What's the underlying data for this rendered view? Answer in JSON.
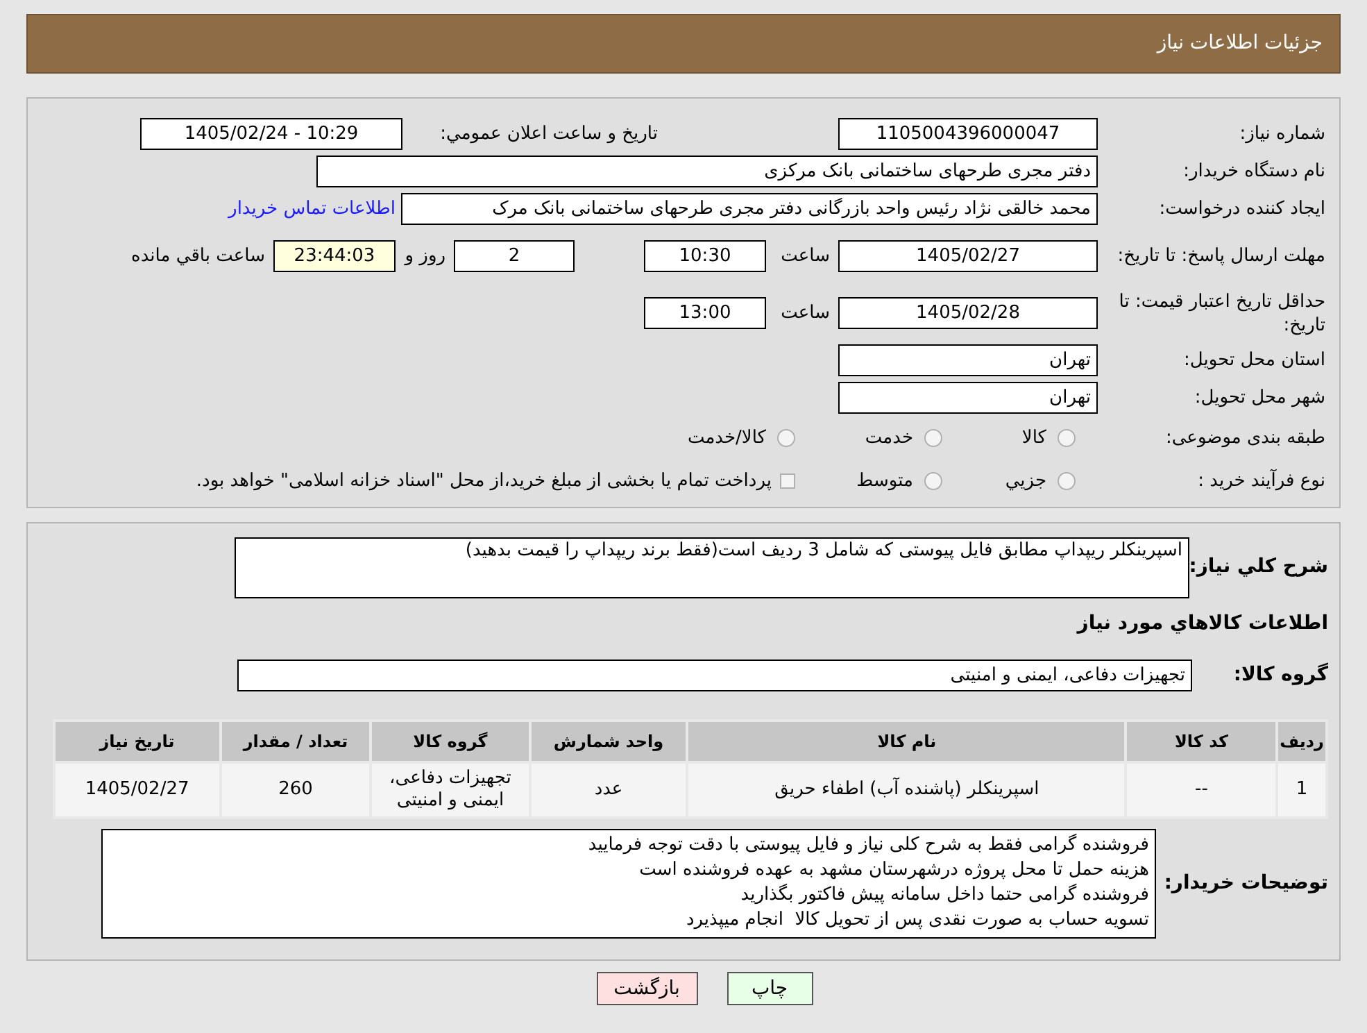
{
  "header": {
    "title": "جزئیات اطلاعات نیاز"
  },
  "details": {
    "need_number": {
      "label": "شماره نیاز:",
      "value": "1105004396000047"
    },
    "announce": {
      "label": "تاریخ و ساعت اعلان عمومي:",
      "value": "1405/02/24 - 10:29"
    },
    "buyer_org": {
      "label": "نام دستگاه خریدار:",
      "value": "دفتر مجری طرحهای ساختمانی بانک مرکزی"
    },
    "requester": {
      "label": "ایجاد کننده درخواست:",
      "value": "محمد خالقی نژاد رئیس واحد بازرگانی دفتر مجری طرحهای ساختمانی بانک مرک",
      "contact_link": "اطلاعات تماس خریدار"
    },
    "response_deadline": {
      "label": "مهلت ارسال پاسخ: تا تاریخ:",
      "date": "1405/02/27",
      "time_label": "ساعت",
      "time": "10:30",
      "days": "2",
      "days_label": "روز و",
      "remaining": "23:44:03",
      "remaining_label": "ساعت باقي مانده"
    },
    "price_validity": {
      "label": "حداقل تاریخ اعتبار قیمت: تا تاریخ:",
      "date": "1405/02/28",
      "time_label": "ساعت",
      "time": "13:00"
    },
    "province": {
      "label": "استان محل تحویل:",
      "value": "تهران"
    },
    "city": {
      "label": "شهر محل تحویل:",
      "value": "تهران"
    },
    "category": {
      "label": "طبقه بندی موضوعی:",
      "options": [
        {
          "label": "کالا",
          "selected": false
        },
        {
          "label": "خدمت",
          "selected": false
        },
        {
          "label": "کالا/خدمت",
          "selected": false
        }
      ]
    },
    "purchase_type": {
      "label": "نوع فرآیند خرید :",
      "options": [
        {
          "label": "جزيي",
          "selected": false
        },
        {
          "label": "متوسط",
          "selected": false
        }
      ],
      "treasury": {
        "label": "پرداخت تمام یا بخشی از مبلغ خرید،از محل \"اسناد خزانه اسلامی\" خواهد بود.",
        "checked": false
      }
    }
  },
  "summary": {
    "label": "شرح کلي نیاز:",
    "value": "اسپرینکلر ریپداپ مطابق فایل پیوستی که شامل 3 ردیف است(فقط برند ریپداپ را قیمت بدهید)"
  },
  "goods": {
    "title": "اطلاعات کالاهاي مورد نیاز",
    "group": {
      "label": "گروه کالا:",
      "value": "تجهیزات دفاعی، ایمنی و امنیتی"
    },
    "table": {
      "columns": [
        "ردیف",
        "کد کالا",
        "نام کالا",
        "واحد شمارش",
        "گروه کالا",
        "تعداد / مقدار",
        "تاریخ نیاز"
      ],
      "rows": [
        [
          "1",
          "--",
          "اسپرینکلر (پاشنده آب) اطفاء حریق",
          "عدد",
          "تجهیزات دفاعی، ایمنی و امنیتی",
          "260",
          "1405/02/27"
        ]
      ]
    }
  },
  "buyer_notes": {
    "label": "توضیحات خریدار:",
    "lines": [
      "فروشنده گرامی فقط به شرح کلی نیاز و فایل پیوستی با دقت توجه فرمایید",
      "هزینه حمل تا محل پروژه درشهرستان مشهد به عهده فروشنده است",
      "فروشنده گرامی حتما داخل سامانه پیش فاکتور بگذارید",
      "تسویه حساب به صورت نقدی پس از تحویل کالا  انجام میپذیرد"
    ]
  },
  "buttons": [
    {
      "label": "چاپ",
      "kind": "print"
    },
    {
      "label": "بازگشت",
      "kind": "back"
    }
  ]
}
